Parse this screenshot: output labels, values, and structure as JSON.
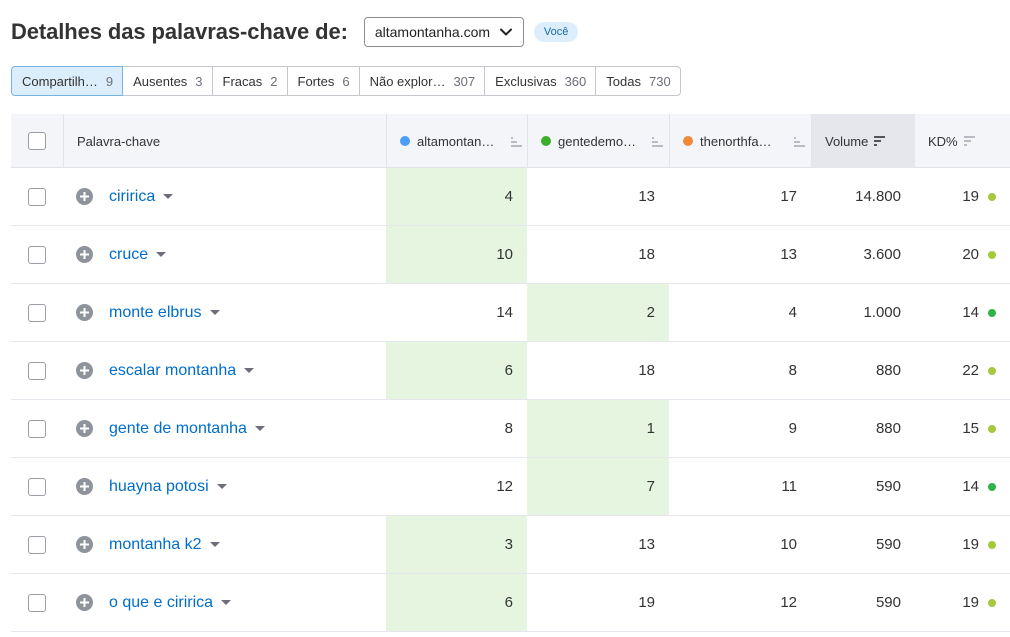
{
  "header": {
    "title": "Detalhes das palavras-chave de:",
    "domain_selected": "altamontanha.com",
    "badge": "Você"
  },
  "tabs": [
    {
      "label": "Compartilh…",
      "count": "9",
      "active": true
    },
    {
      "label": "Ausentes",
      "count": "3",
      "active": false
    },
    {
      "label": "Fracas",
      "count": "2",
      "active": false
    },
    {
      "label": "Fortes",
      "count": "6",
      "active": false
    },
    {
      "label": "Não explor…",
      "count": "307",
      "active": false
    },
    {
      "label": "Exclusivas",
      "count": "360",
      "active": false
    },
    {
      "label": "Todas",
      "count": "730",
      "active": false
    }
  ],
  "columns": {
    "keyword": "Palavra-chave",
    "domain_a": "altamontan…",
    "domain_b": "gentedemo…",
    "domain_c": "thenorthfa…",
    "volume": "Volume",
    "kd": "KD%"
  },
  "colors": {
    "domain_a": "#4a9ff5",
    "domain_b": "#3dae2b",
    "domain_c": "#f0893a",
    "kd_light": "#a6c83b",
    "kd_green": "#2fb344",
    "highlight": "#e5f5df",
    "link": "#006dca"
  },
  "rows": [
    {
      "keyword": "ciririca",
      "a": "4",
      "b": "13",
      "c": "17",
      "volume": "14.800",
      "kd": "19",
      "best": "a",
      "kd_color": "#a6c83b"
    },
    {
      "keyword": "cruce",
      "a": "10",
      "b": "18",
      "c": "13",
      "volume": "3.600",
      "kd": "20",
      "best": "a",
      "kd_color": "#a6c83b"
    },
    {
      "keyword": "monte elbrus",
      "a": "14",
      "b": "2",
      "c": "4",
      "volume": "1.000",
      "kd": "14",
      "best": "b",
      "kd_color": "#2fb344"
    },
    {
      "keyword": "escalar montanha",
      "a": "6",
      "b": "18",
      "c": "8",
      "volume": "880",
      "kd": "22",
      "best": "a",
      "kd_color": "#a6c83b"
    },
    {
      "keyword": "gente de montanha",
      "a": "8",
      "b": "1",
      "c": "9",
      "volume": "880",
      "kd": "15",
      "best": "b",
      "kd_color": "#a6c83b"
    },
    {
      "keyword": "huayna potosi",
      "a": "12",
      "b": "7",
      "c": "11",
      "volume": "590",
      "kd": "14",
      "best": "b",
      "kd_color": "#2fb344"
    },
    {
      "keyword": "montanha k2",
      "a": "3",
      "b": "13",
      "c": "10",
      "volume": "590",
      "kd": "19",
      "best": "a",
      "kd_color": "#a6c83b"
    },
    {
      "keyword": "o que e ciririca",
      "a": "6",
      "b": "19",
      "c": "12",
      "volume": "590",
      "kd": "19",
      "best": "a",
      "kd_color": "#a6c83b"
    }
  ]
}
